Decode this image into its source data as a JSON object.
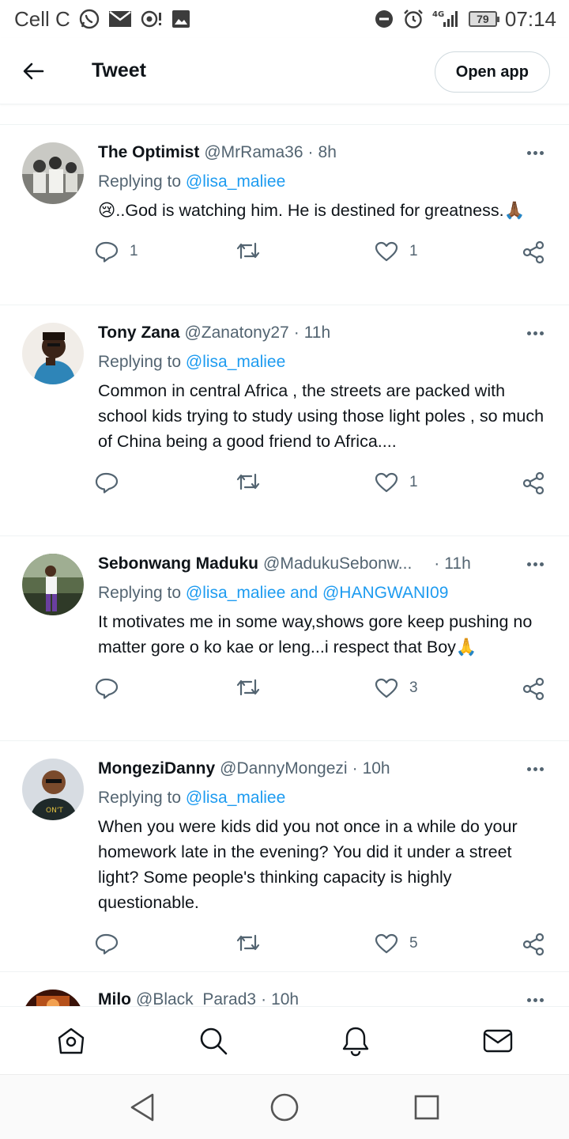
{
  "status_bar": {
    "carrier": "Cell C",
    "battery": "79",
    "time": "07:14",
    "network": "4G"
  },
  "header": {
    "title": "Tweet",
    "open_app": "Open app"
  },
  "tweets": [
    {
      "name": "The Optimist",
      "handle": "@MrRama36",
      "time": "8h",
      "replying_prefix": "Replying to ",
      "replying_to": "@lisa_maliee",
      "text": "😢..God is watching him. He is destined for greatness.🙏🏾",
      "replies": "1",
      "retweets": "",
      "likes": "1"
    },
    {
      "name": "Tony Zana",
      "handle": "@Zanatony27",
      "time": "11h",
      "replying_prefix": "Replying to ",
      "replying_to": "@lisa_maliee",
      "text": "Common in central Africa , the streets are packed with school kids trying to study using those light poles , so much of China being a good friend to Africa....",
      "replies": "",
      "retweets": "",
      "likes": "1"
    },
    {
      "name": "Sebonwang Maduku",
      "handle": "@MadukuSebonw...",
      "time": "11h",
      "replying_prefix": "Replying to ",
      "replying_to": "@lisa_maliee and @HANGWANI09",
      "text": "It motivates me in some way,shows gore keep pushing no matter gore o ko kae or leng...i respect that Boy🙏",
      "replies": "",
      "retweets": "",
      "likes": "3"
    },
    {
      "name": "MongeziDanny",
      "handle": "@DannyMongezi",
      "time": "10h",
      "replying_prefix": "Replying to ",
      "replying_to": "@lisa_maliee",
      "text": "When you were kids did you not once in a while do your homework late in the evening? You did it under a street light? Some people's thinking capacity is highly questionable.",
      "replies": "",
      "retweets": "",
      "likes": "5"
    },
    {
      "name": "Milo",
      "handle": "@Black_Parad3",
      "time": "10h"
    }
  ],
  "colors": {
    "link": "#1d9bf0",
    "secondary_text": "#536471",
    "primary_text": "#0f1419"
  }
}
